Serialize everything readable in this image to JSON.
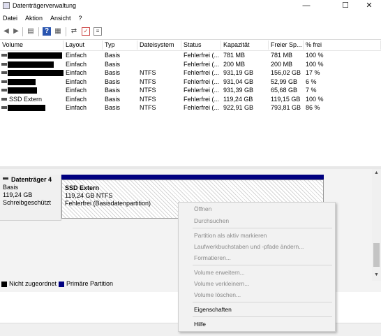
{
  "window": {
    "title": "Datenträgerverwaltung",
    "minimize_glyph": "—",
    "maximize_glyph": "☐",
    "close_glyph": "✕"
  },
  "menu": [
    "Datei",
    "Aktion",
    "Ansicht",
    "?"
  ],
  "toolbar": {
    "back": "◀",
    "forward": "▶",
    "properties": "▤",
    "help": "?",
    "view": "▦",
    "connect": "⇄",
    "check": "✓",
    "list": "≡"
  },
  "table": {
    "columns": [
      "Volume",
      "Layout",
      "Typ",
      "Dateisystem",
      "Status",
      "Kapazität",
      "Freier Sp...",
      "% frei"
    ],
    "rows": [
      {
        "volume": "",
        "layout": "Einfach",
        "typ": "Basis",
        "fs": "",
        "status": "Fehlerfrei (...",
        "cap": "781 MB",
        "free": "781 MB",
        "pct": "100 %"
      },
      {
        "volume": "",
        "layout": "Einfach",
        "typ": "Basis",
        "fs": "",
        "status": "Fehlerfrei (...",
        "cap": "200 MB",
        "free": "200 MB",
        "pct": "100 %"
      },
      {
        "volume": "",
        "layout": "Einfach",
        "typ": "Basis",
        "fs": "NTFS",
        "status": "Fehlerfrei (...",
        "cap": "931,19 GB",
        "free": "156,02 GB",
        "pct": "17 %"
      },
      {
        "volume": "",
        "layout": "Einfach",
        "typ": "Basis",
        "fs": "NTFS",
        "status": "Fehlerfrei (...",
        "cap": "931,04 GB",
        "free": "52,99 GB",
        "pct": "6 %"
      },
      {
        "volume": "",
        "layout": "Einfach",
        "typ": "Basis",
        "fs": "NTFS",
        "status": "Fehlerfrei (...",
        "cap": "931,39 GB",
        "free": "65,68 GB",
        "pct": "7 %"
      },
      {
        "volume": "SSD Extern",
        "layout": "Einfach",
        "typ": "Basis",
        "fs": "NTFS",
        "status": "Fehlerfrei (...",
        "cap": "119,24 GB",
        "free": "119,15 GB",
        "pct": "100 %"
      },
      {
        "volume": "",
        "layout": "Einfach",
        "typ": "Basis",
        "fs": "NTFS",
        "status": "Fehlerfrei (...",
        "cap": "922,91 GB",
        "free": "793,81 GB",
        "pct": "86 %"
      }
    ]
  },
  "disk": {
    "name": "Datenträger 4",
    "type": "Basis",
    "size": "119,24 GB",
    "state": "Schreibgeschützt"
  },
  "partition": {
    "name": "SSD Extern",
    "size_fs": "119,24 GB NTFS",
    "status": "Fehlerfrei (Basisdatenpartition)",
    "bar_color": "#000080"
  },
  "legend": [
    {
      "label": "Nicht zugeordnet",
      "color": "#000000"
    },
    {
      "label": "Primäre Partition",
      "color": "#000080"
    }
  ],
  "context_menu": {
    "open": "Öffnen",
    "explore": "Durchsuchen",
    "mark_active": "Partition als aktiv markieren",
    "change_letter": "Laufwerkbuchstaben und -pfade ändern...",
    "format": "Formatieren...",
    "extend": "Volume erweitern...",
    "shrink": "Volume verkleinern...",
    "delete": "Volume löschen...",
    "properties": "Eigenschaften",
    "help": "Hilfe"
  }
}
